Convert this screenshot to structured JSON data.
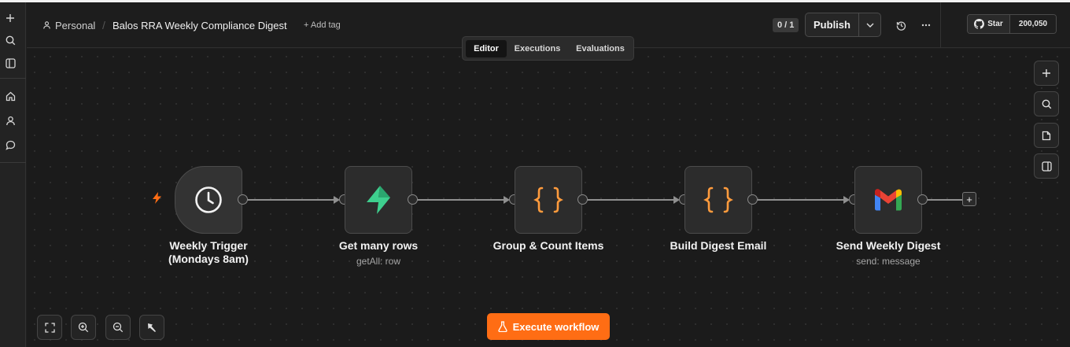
{
  "header": {
    "project": "Personal",
    "workflow_title": "Balos RRA Weekly Compliance Digest",
    "add_tag": "+ Add tag",
    "counter": "0 / 1",
    "publish_label": "Publish",
    "github_star_label": "Star",
    "github_star_count": "200,050"
  },
  "tabs": [
    {
      "label": "Editor",
      "active": true
    },
    {
      "label": "Executions",
      "active": false
    },
    {
      "label": "Evaluations",
      "active": false
    }
  ],
  "nodes": [
    {
      "name": "Weekly Trigger (Mondays 8am)",
      "line1": "Weekly Trigger",
      "line2": "(Mondays 8am)",
      "subtitle": "",
      "icon": "clock-icon"
    },
    {
      "name": "Get many rows",
      "subtitle": "getAll: row",
      "icon": "supabase-icon"
    },
    {
      "name": "Group & Count Items",
      "subtitle": "",
      "icon": "code-braces-icon"
    },
    {
      "name": "Build Digest Email",
      "subtitle": "",
      "icon": "code-braces-icon"
    },
    {
      "name": "Send Weekly Digest",
      "subtitle": "send: message",
      "icon": "gmail-icon"
    }
  ],
  "footer": {
    "execute_label": "Execute workflow"
  },
  "colors": {
    "accent": "#ff6d14",
    "code_icon": "#ff9b3d",
    "supabase": "#3ecf8e",
    "background": "#1b1b1b"
  }
}
